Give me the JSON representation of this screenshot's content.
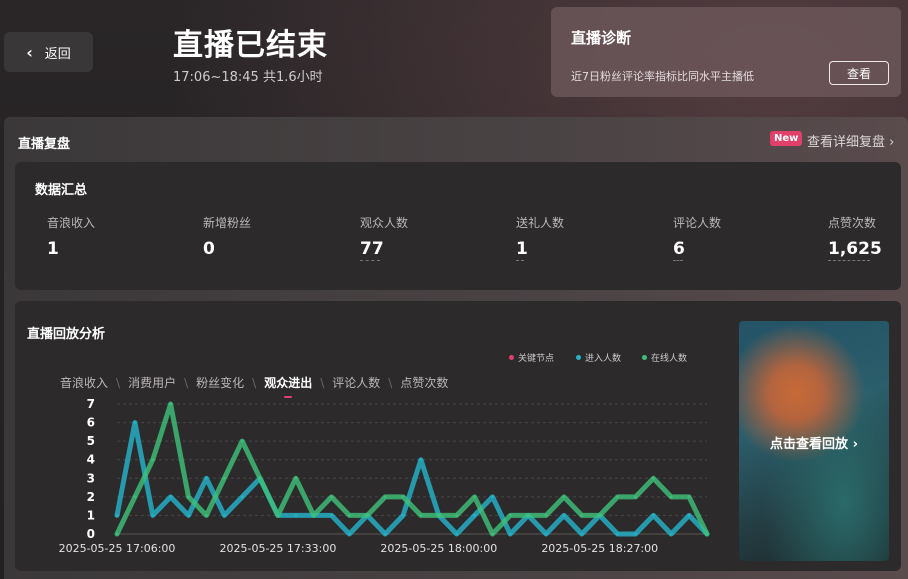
{
  "header": {
    "back_label": "返回",
    "title": "直播已结束",
    "time_range": "17:06~18:45 共1.6小时"
  },
  "diagnosis": {
    "title": "直播诊断",
    "summary": "近7日粉丝评论率指标比同水平主播低",
    "view_label": "查看"
  },
  "review": {
    "title": "直播复盘",
    "new_badge": "New",
    "detail_link": "查看详细复盘"
  },
  "summary": {
    "title": "数据汇总",
    "metrics": [
      {
        "label": "音浪收入",
        "value": "1",
        "underline": false
      },
      {
        "label": "新增粉丝",
        "value": "0",
        "underline": false
      },
      {
        "label": "观众人数",
        "value": "77",
        "underline": true
      },
      {
        "label": "送礼人数",
        "value": "1",
        "underline": true
      },
      {
        "label": "评论人数",
        "value": "6",
        "underline": true
      },
      {
        "label": "点赞次数",
        "value": "1,625",
        "underline": true
      }
    ]
  },
  "replay": {
    "title": "直播回放分析",
    "legend": [
      {
        "label": "关键节点",
        "color": "#e0406a"
      },
      {
        "label": "进入人数",
        "color": "#25b3c9"
      },
      {
        "label": "在线人数",
        "color": "#3ec07a"
      }
    ],
    "tabs": [
      "音浪收入",
      "消费用户",
      "粉丝变化",
      "观众进出",
      "评论人数",
      "点赞次数"
    ],
    "active_tab": "观众进出",
    "thumbnail_label": "点击查看回放"
  },
  "chart_data": {
    "type": "line",
    "x": [
      "17:06",
      "17:09",
      "17:12",
      "17:15",
      "17:18",
      "17:21",
      "17:24",
      "17:27",
      "17:30",
      "17:33",
      "17:36",
      "17:39",
      "17:42",
      "17:45",
      "17:48",
      "17:51",
      "17:54",
      "17:57",
      "18:00",
      "18:03",
      "18:06",
      "18:09",
      "18:12",
      "18:15",
      "18:18",
      "18:21",
      "18:24",
      "18:27",
      "18:30",
      "18:33",
      "18:36",
      "18:39",
      "18:42",
      "18:45"
    ],
    "x_ticks": [
      "2025-05-25 17:06:00",
      "2025-05-25 17:33:00",
      "2025-05-25 18:00:00",
      "2025-05-25 18:27:00"
    ],
    "ylim": [
      0,
      7
    ],
    "y_ticks": [
      "0",
      "1",
      "2",
      "3",
      "4",
      "5",
      "6",
      "7"
    ],
    "grid": true,
    "series": [
      {
        "name": "进入人数",
        "color": "#25b3c9",
        "values": [
          1,
          6,
          1,
          2,
          1,
          3,
          1,
          2,
          3,
          1,
          1,
          1,
          1,
          0,
          1,
          0,
          1,
          4,
          1,
          0,
          1,
          2,
          0,
          1,
          0,
          1,
          0,
          1,
          0,
          0,
          1,
          0,
          1,
          0
        ]
      },
      {
        "name": "在线人数",
        "color": "#3ec07a",
        "values": [
          0,
          2,
          4,
          7,
          2,
          1,
          3,
          5,
          3,
          1,
          3,
          1,
          2,
          1,
          1,
          2,
          2,
          1,
          1,
          1,
          2,
          0,
          1,
          1,
          1,
          2,
          1,
          1,
          2,
          2,
          3,
          2,
          2,
          0
        ]
      }
    ]
  }
}
